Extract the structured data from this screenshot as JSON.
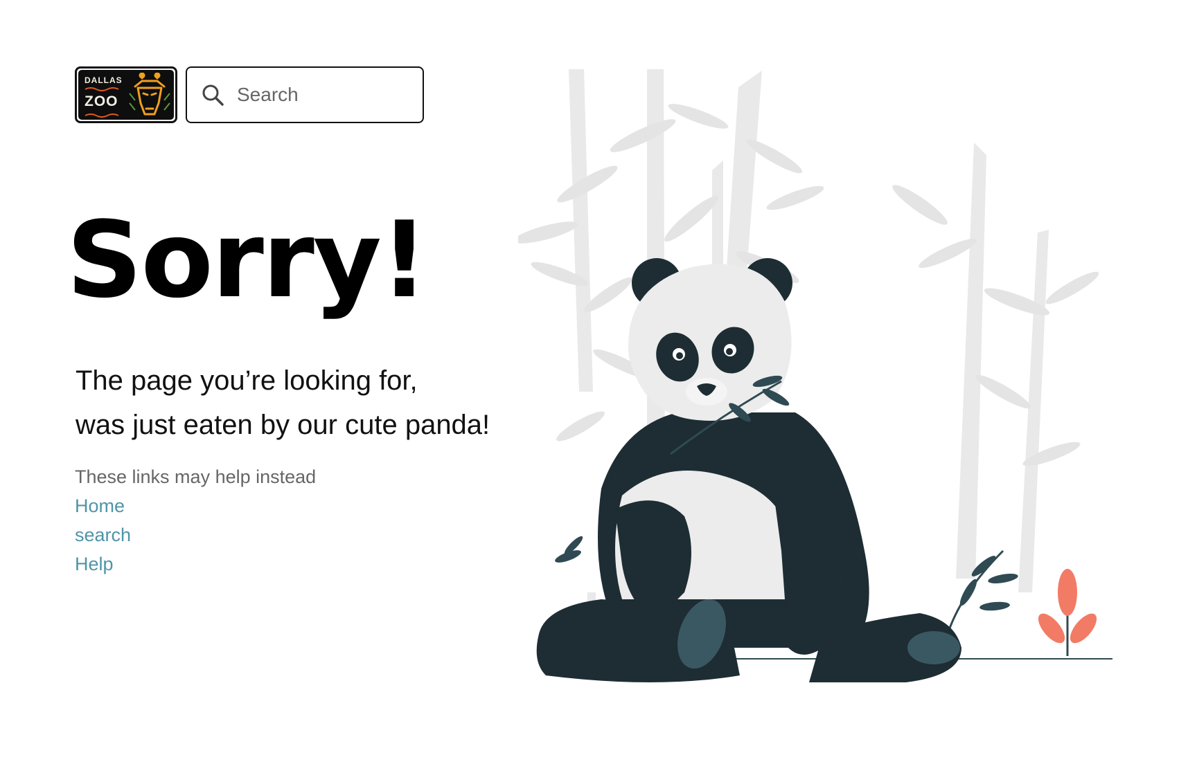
{
  "header": {
    "logo": {
      "line1": "DALLAS",
      "line2": "ZOO",
      "icon": "giraffe-icon"
    },
    "search": {
      "placeholder": "Search",
      "icon": "search-icon"
    }
  },
  "main": {
    "headline": "Sorry!",
    "message_line1": "The page you’re looking for,",
    "message_line2": "was just eaten by our cute panda!",
    "links_intro": "These links may help instead",
    "links": [
      {
        "label": "Home"
      },
      {
        "label": "search"
      },
      {
        "label": "Help"
      }
    ]
  },
  "illustration": {
    "subject": "panda-eating-bamboo",
    "colors": {
      "panda_dark": "#1d2d33",
      "panda_light": "#ececec",
      "bamboo": "#e6e6e6",
      "flower": "#f27b66",
      "leaf": "#2f4a52"
    }
  },
  "colors": {
    "link": "#4f95a8",
    "muted_text": "#666666",
    "text": "#000000"
  }
}
